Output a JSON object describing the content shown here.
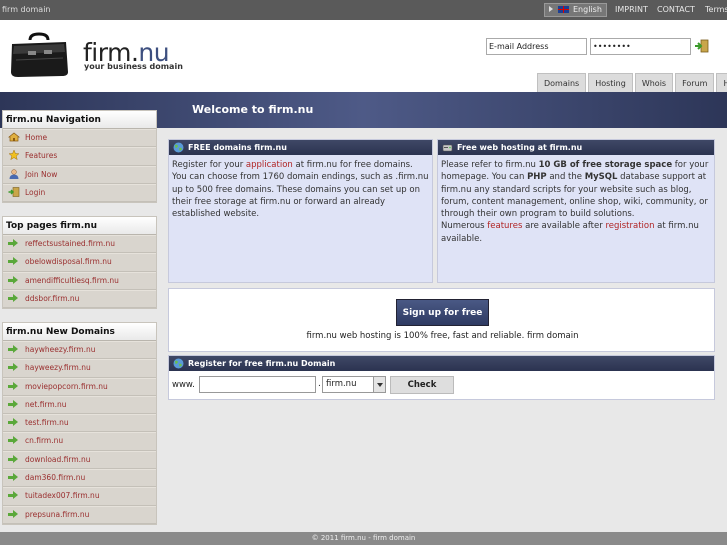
{
  "topbar": {
    "site": "firm domain",
    "language": "English",
    "links": [
      "IMPRINT",
      "CONTACT",
      "Terms"
    ]
  },
  "header": {
    "logo_main": "firm.",
    "logo_accent": "nu",
    "logo_sub": "your business domain",
    "email_value": "E-mail Address",
    "password_value": "••••••••",
    "tabs": [
      "Domains",
      "Hosting",
      "Whois",
      "Forum",
      "Help"
    ]
  },
  "banner": {
    "welcome": "Welcome to firm.nu"
  },
  "nav": {
    "title": "firm.nu Navigation",
    "items": [
      {
        "label": "Home",
        "icon": "home-icon"
      },
      {
        "label": "Features",
        "icon": "star-icon"
      },
      {
        "label": "Join Now",
        "icon": "user-icon"
      },
      {
        "label": "Login",
        "icon": "login-icon"
      }
    ]
  },
  "top_pages": {
    "title": "Top pages firm.nu",
    "items": [
      "reffectsustained.firm.nu",
      "obelowdisposal.firm.nu",
      "amendifficultiesq.firm.nu",
      "ddsbor.firm.nu"
    ]
  },
  "new_domains": {
    "title": "firm.nu New Domains",
    "items": [
      "haywheezy.firm.nu",
      "hayweezy.firm.nu",
      "moviepopcorn.firm.nu",
      "net.firm.nu",
      "test.firm.nu",
      "cn.firm.nu",
      "download.firm.nu",
      "dam360.firm.nu",
      "tuitadex007.firm.nu",
      "prepsuna.firm.nu"
    ]
  },
  "free_domains": {
    "title": "FREE domains firm.nu",
    "p1": "Register for your ",
    "link": "application",
    "p2": " at firm.nu for free domains. You can choose from 1760 domain endings, such as .firm.nu up to 500 free domains. These domains you can set up on their free storage at firm.nu or forward an already established website."
  },
  "free_hosting": {
    "title": "Free web hosting at firm.nu",
    "a1": "Please refer to firm.nu ",
    "b1": "10 GB of free storage space",
    "a2": " for your homepage. You can ",
    "b2": "PHP",
    "a3": " and the ",
    "b3": "MySQL",
    "a4": " database support at firm.nu any standard scripts for your website such as blog, forum, content management, online shop, wiki, community, or through their own program to build solutions.",
    "a5": "Numerous ",
    "link1": "features",
    "a6": " are available after ",
    "link2": "registration",
    "a7": " at firm.nu available."
  },
  "signup": {
    "button": "Sign up for free",
    "text": "firm.nu web hosting is 100% free, fast and reliable. firm domain"
  },
  "register": {
    "title": "Register for free firm.nu Domain",
    "www": "www.",
    "dot": ".",
    "select_value": "firm.nu",
    "check": "Check"
  },
  "footer": {
    "text": "© 2011 firm.nu - firm domain"
  },
  "colors": {
    "accent": "#2e3a62",
    "link": "#b02424",
    "sidebar": "#d9d5ce",
    "box": "#dfe3f6"
  }
}
